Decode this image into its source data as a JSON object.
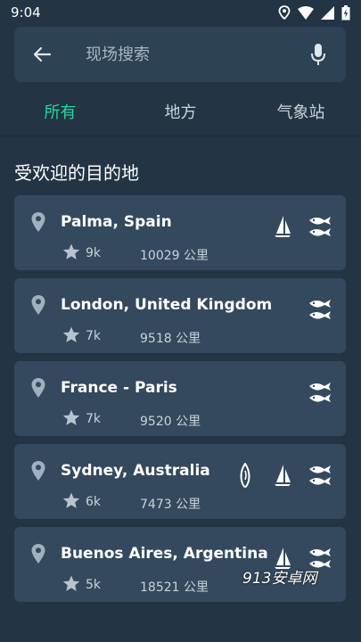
{
  "status": {
    "time": "9:04"
  },
  "search": {
    "placeholder": "现场搜索"
  },
  "tabs": [
    {
      "label": "所有",
      "active": true
    },
    {
      "label": "地方",
      "active": false
    },
    {
      "label": "气象站",
      "active": false
    }
  ],
  "section": {
    "title": "受欢迎的目的地"
  },
  "destinations": [
    {
      "name": "Palma, Spain",
      "rating": "9k",
      "distance": "10029 公里",
      "activities": [
        "sailing-icon",
        "fishing-icon"
      ]
    },
    {
      "name": "London, United Kingdom",
      "rating": "7k",
      "distance": "9518 公里",
      "activities": [
        "fishing-icon"
      ]
    },
    {
      "name": "France - Paris",
      "rating": "7k",
      "distance": "9520 公里",
      "activities": [
        "fishing-icon"
      ]
    },
    {
      "name": "Sydney, Australia",
      "rating": "6k",
      "distance": "7473 公里",
      "activities": [
        "surfing-icon",
        "sailing-icon",
        "fishing-icon"
      ]
    },
    {
      "name": "Buenos Aires, Argentina",
      "rating": "5k",
      "distance": "18521 公里",
      "activities": [
        "sailing-icon",
        "fishing-icon"
      ]
    }
  ],
  "watermark": "913安卓网",
  "colors": {
    "background": "#233444",
    "card": "#34495d",
    "accent": "#2ad6a4"
  }
}
